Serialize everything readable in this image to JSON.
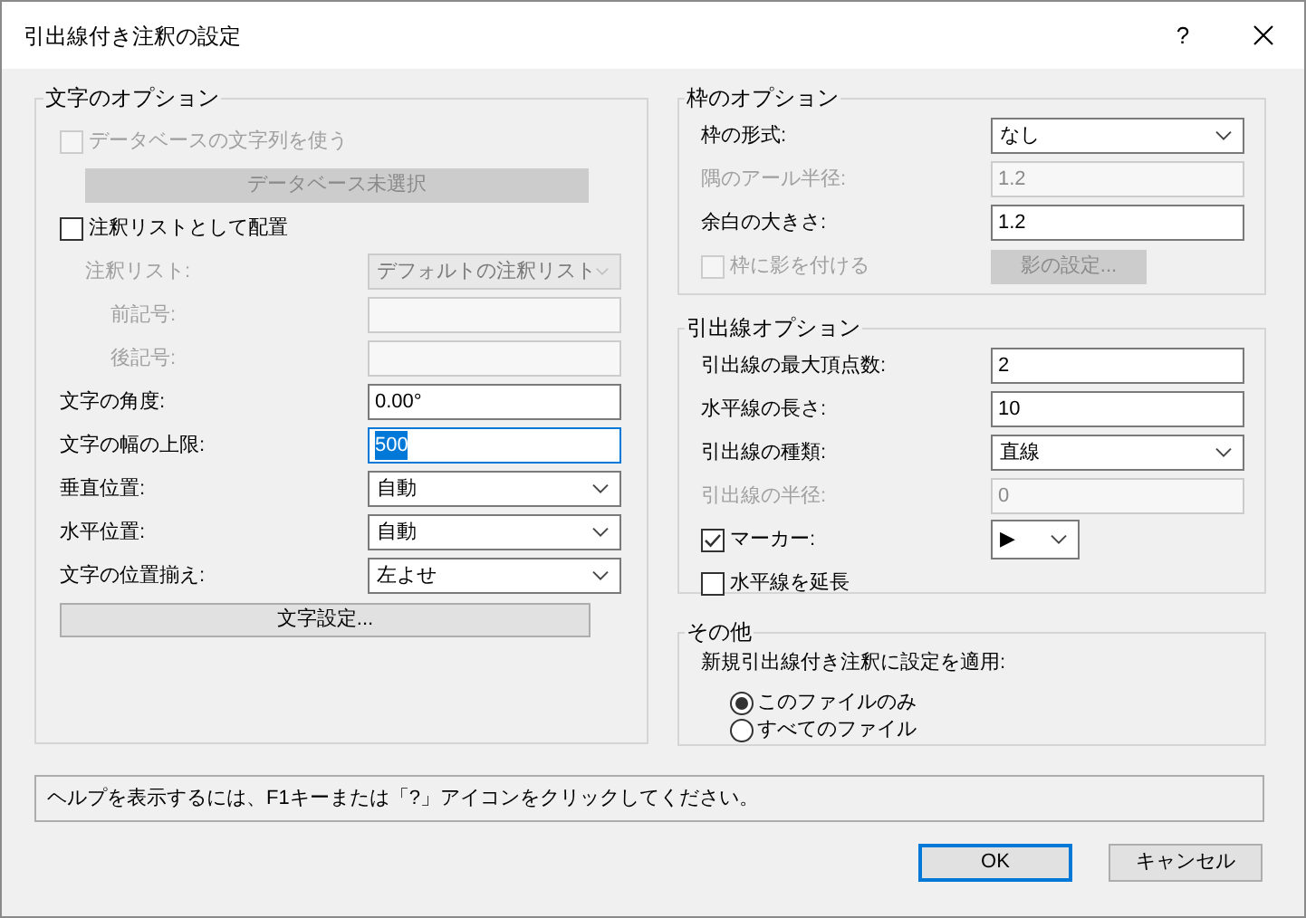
{
  "window": {
    "title": "引出線付き注釈の設定",
    "help_button": "?"
  },
  "text_options": {
    "title": "文字のオプション",
    "items": [
      {
        "kind": "checkbox",
        "label": "データベースの文字列を使う",
        "checked": false,
        "disabled": true,
        "children": [
          {
            "kind": "button",
            "label": "データベース未選択",
            "disabled": true
          }
        ]
      },
      {
        "kind": "checkbox",
        "label": "注釈リストとして配置",
        "checked": false,
        "disabled": false,
        "children": [
          {
            "kind": "dropdown",
            "label": "注釈リスト:",
            "value": "デフォルトの注釈リスト",
            "disabled": true,
            "children": [
              {
                "kind": "field",
                "label": "前記号:",
                "disabled": true
              },
              {
                "kind": "field",
                "label": "後記号:",
                "disabled": true
              }
            ]
          }
        ]
      },
      {
        "kind": "field",
        "label": "文字の角度:",
        "value": "0.00°",
        "disabled": false,
        "focused": false
      },
      {
        "kind": "field",
        "label": "文字の幅の上限:",
        "value": "500",
        "disabled": false,
        "focused": true
      },
      {
        "kind": "dropdown",
        "label": "垂直位置:",
        "value": "自動",
        "disabled": false
      },
      {
        "kind": "dropdown",
        "label": "水平位置:",
        "value": "自動",
        "disabled": false
      },
      {
        "kind": "dropdown",
        "label": "文字の位置揃え:",
        "value": "左よせ",
        "disabled": false
      },
      {
        "kind": "button",
        "label": "文字設定...",
        "disabled": false
      }
    ]
  },
  "frame_options": {
    "title": "枠のオプション",
    "items": [
      {
        "kind": "dropdown",
        "label": "枠の形式:",
        "value": "なし",
        "disabled": false
      },
      {
        "kind": "field",
        "label": "隅のアール半径:",
        "value": "1.2",
        "disabled": true,
        "focused": false
      },
      {
        "kind": "field",
        "label": "余白の大きさ:",
        "value": "1.2",
        "disabled": false,
        "focused": false
      },
      {
        "kind": "checkbox",
        "label": "枠に影を付ける",
        "checked": false,
        "disabled": true,
        "button": {
          "label": "影の設定...",
          "disabled": true
        }
      }
    ]
  },
  "leader_options": {
    "title": "引出線オプション",
    "items": [
      {
        "kind": "field",
        "label": "引出線の最大頂点数:",
        "value": "2",
        "disabled": false,
        "focused": false
      },
      {
        "kind": "field",
        "label": "水平線の長さ:",
        "value": "10",
        "disabled": false,
        "focused": false
      },
      {
        "kind": "dropdown",
        "label": "引出線の種類:",
        "value": "直線",
        "disabled": false
      },
      {
        "kind": "field",
        "label": "引出線の半径:",
        "value": "0",
        "disabled": true,
        "focused": false
      },
      {
        "kind": "checkbox",
        "label": "マーカー:",
        "checked": true,
        "disabled": false,
        "dropdown": {
          "value": "▶"
        }
      },
      {
        "kind": "checkbox",
        "label": "水平線を延長",
        "checked": false,
        "disabled": false
      }
    ]
  },
  "other": {
    "title": "その他",
    "label": "新規引出線付き注釈に設定を適用:",
    "options": [
      {
        "label": "このファイルのみ",
        "selected": true
      },
      {
        "label": "すべてのファイル",
        "selected": false
      }
    ]
  },
  "help_text": "ヘルプを表示するには、F1キーまたは「?」アイコンをクリックしてください。",
  "buttons": [
    {
      "label": "OK",
      "default": true
    },
    {
      "label": "キャンセル",
      "default": false
    }
  ]
}
